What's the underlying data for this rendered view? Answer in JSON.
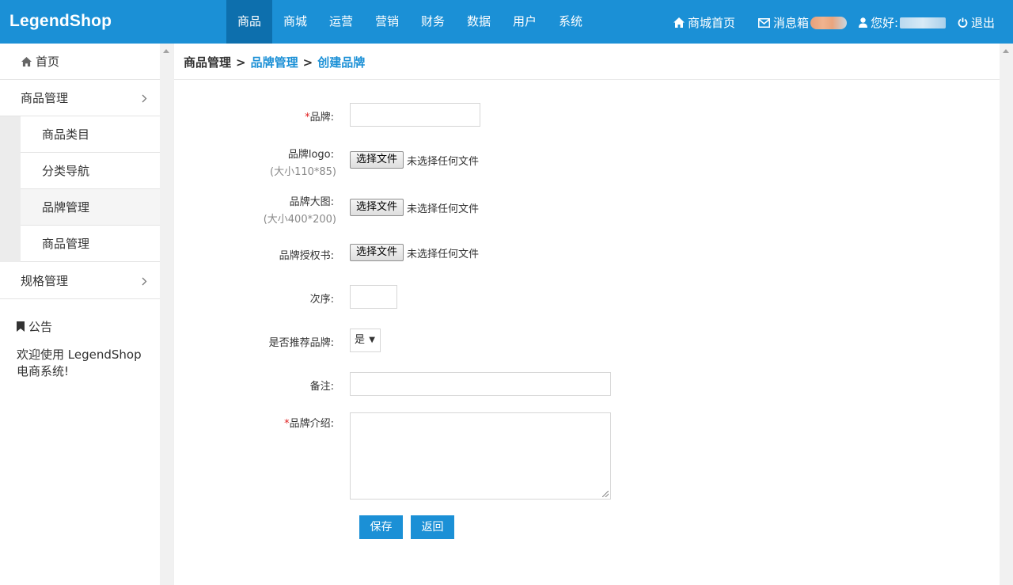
{
  "header": {
    "logo": "LegendShop",
    "nav": [
      "商品",
      "商城",
      "运营",
      "营销",
      "财务",
      "数据",
      "用户",
      "系统"
    ],
    "active_nav": "商品",
    "shop_home": "商城首页",
    "messages": "消息箱",
    "greeting": "您好:",
    "logout": "退出",
    "accent_color": "#1b90d6",
    "active_bg": "#0d6fad"
  },
  "sidebar": {
    "home": "首页",
    "goods_management": "商品管理",
    "sub_items": [
      "商品类目",
      "分类导航",
      "品牌管理",
      "商品管理"
    ],
    "active_sub": "品牌管理",
    "spec_management": "规格管理",
    "notice_title": "公告",
    "notice_text": "欢迎使用 LegendShop 电商系统!"
  },
  "breadcrumb": {
    "root": "商品管理",
    "sep": ">",
    "level2": "品牌管理",
    "level3": "创建品牌"
  },
  "form": {
    "brand_label": "品牌:",
    "brand_value": "",
    "logo_label": "品牌logo:",
    "logo_hint": "(大小110*85)",
    "bigimg_label": "品牌大图:",
    "bigimg_hint": "(大小400*200)",
    "auth_label": "品牌授权书:",
    "choose_file": "选择文件",
    "no_file": "未选择任何文件",
    "order_label": "次序:",
    "order_value": "",
    "recommend_label": "是否推荐品牌:",
    "recommend_value": "是",
    "remark_label": "备注:",
    "remark_value": "",
    "intro_label": "品牌介绍:",
    "intro_value": "",
    "required_mark": "*",
    "save": "保存",
    "back": "返回"
  }
}
